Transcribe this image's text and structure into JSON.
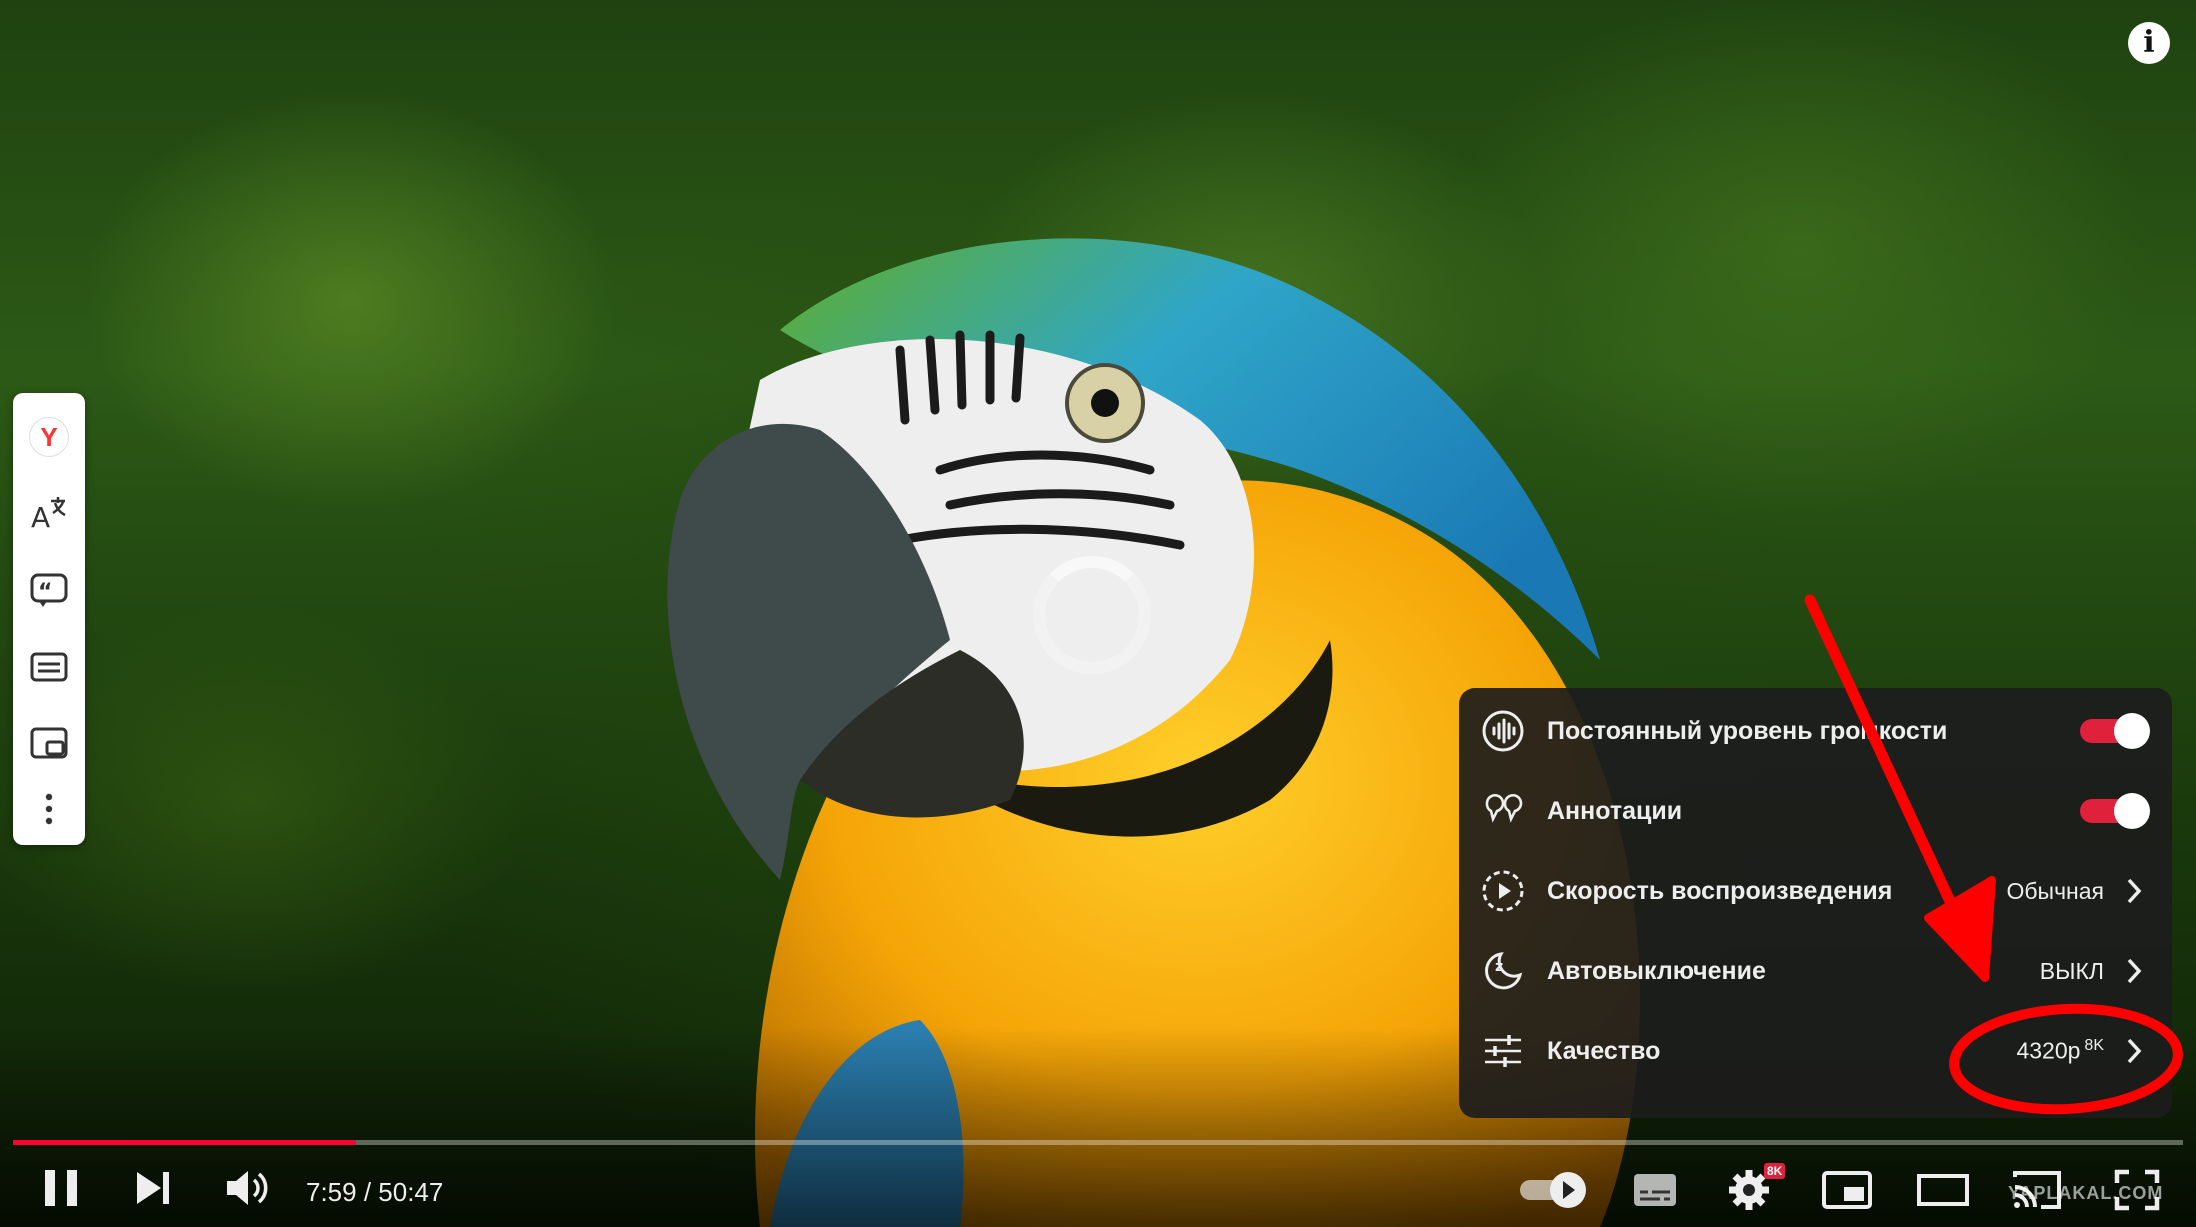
{
  "sidebar": {
    "icons": [
      "yandex-logo-icon",
      "translate-icon",
      "quote-icon",
      "subtitles-icon",
      "picture-in-picture-icon",
      "more-vertical-icon"
    ],
    "logo_letter": "Y"
  },
  "settings_menu": {
    "rows": [
      {
        "label": "Постоянный уровень громкости",
        "type": "toggle",
        "on": true
      },
      {
        "label": "Аннотации",
        "type": "toggle",
        "on": true
      },
      {
        "label": "Скорость воспроизведения",
        "type": "submenu",
        "value": "Обычная"
      },
      {
        "label": "Автовыключение",
        "type": "submenu",
        "value": "ВЫКЛ"
      },
      {
        "label": "Качество",
        "type": "submenu",
        "value": "4320p",
        "value_sup": "8K"
      }
    ]
  },
  "player": {
    "time": "7:59 / 50:47",
    "progress_fraction": 0.158,
    "quality_badge": "8K",
    "info_glyph": "i"
  },
  "watermark": "YAPLAKAL.COM",
  "colors": {
    "accent": "#ff0033",
    "toggle_on": "#e0213b",
    "annotation": "#ff0000"
  }
}
